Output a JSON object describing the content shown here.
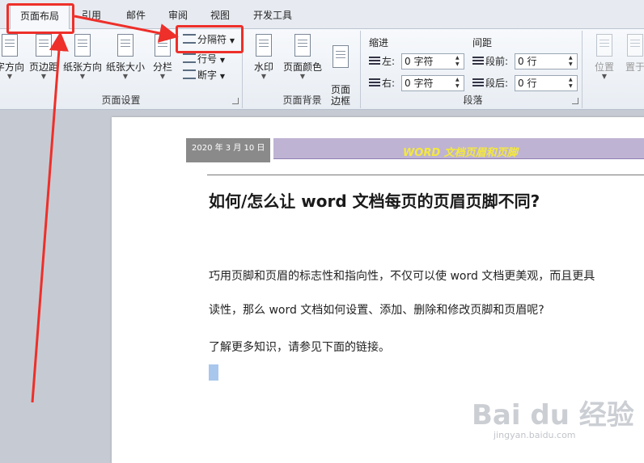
{
  "tabs": [
    "页面布局",
    "引用",
    "邮件",
    "审阅",
    "视图",
    "开发工具"
  ],
  "page_setup": {
    "group_label": "页面设置",
    "buttons": [
      "字方向",
      "页边距",
      "纸张方向",
      "纸张大小",
      "分栏"
    ],
    "small_buttons": [
      "分隔符",
      "行号",
      "断字"
    ]
  },
  "page_background": {
    "group_label": "页面背景",
    "buttons": [
      "水印",
      "页面颜色",
      "页面\n边框"
    ]
  },
  "paragraph": {
    "group_label": "段落",
    "indent_head": "缩进",
    "spacing_head": "间距",
    "left_label": "左:",
    "right_label": "右:",
    "before_label": "段前:",
    "after_label": "段后:",
    "left_value": "0 字符",
    "right_value": "0 字符",
    "before_value": "0 行",
    "after_value": "0 行"
  },
  "arrange": {
    "buttons": [
      "位置",
      "置于"
    ]
  },
  "document": {
    "header_date": "2020 年 3 月 10 日",
    "header_title": "WORD 文档页眉和页脚",
    "title": "如何/怎么让 word 文档每页的页眉页脚不同?",
    "para1": "巧用页脚和页眉的标志性和指向性，不仅可以使 word 文档更美观，而且更具",
    "para2": "读性，那么 word 文档如何设置、添加、删除和修改页脚和页眉呢?",
    "para3": "了解更多知识，请参见下面的链接。"
  },
  "watermark": {
    "brand": "Bai du 经验",
    "url": "jingyan.baidu.com"
  },
  "colors": {
    "annotation": "#ee2f2a",
    "header_band": "#bfb3d3",
    "header_title": "#f4e93c"
  }
}
